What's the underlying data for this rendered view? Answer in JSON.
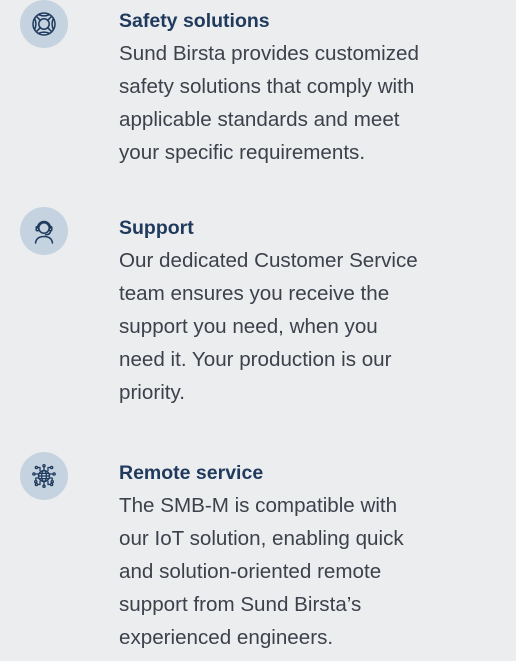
{
  "features": [
    {
      "icon": "lifebuoy-icon",
      "title": "Safety solutions",
      "lines": [
        "Sund Birsta provides customized",
        "safety solutions that comply with",
        "applicable standards and meet",
        "your specific requirements."
      ]
    },
    {
      "icon": "headset-support-icon",
      "title": "Support",
      "lines": [
        "Our dedicated Customer Service",
        "team ensures you receive the",
        "support you need, when you",
        "need it. Your production is our",
        "priority."
      ]
    },
    {
      "icon": "network-globe-icon",
      "title": "Remote service",
      "lines": [
        "The SMB-M is compatible with",
        "our IoT solution, enabling quick",
        "and solution-oriented remote",
        "support from Sund Birsta’s",
        "experienced engineers."
      ]
    }
  ],
  "colors": {
    "background": "#ecedef",
    "icon_circle": "#c5d3e1",
    "icon_stroke": "#1f3a5c",
    "title": "#1f3a5c",
    "body_text": "#3c414b"
  }
}
